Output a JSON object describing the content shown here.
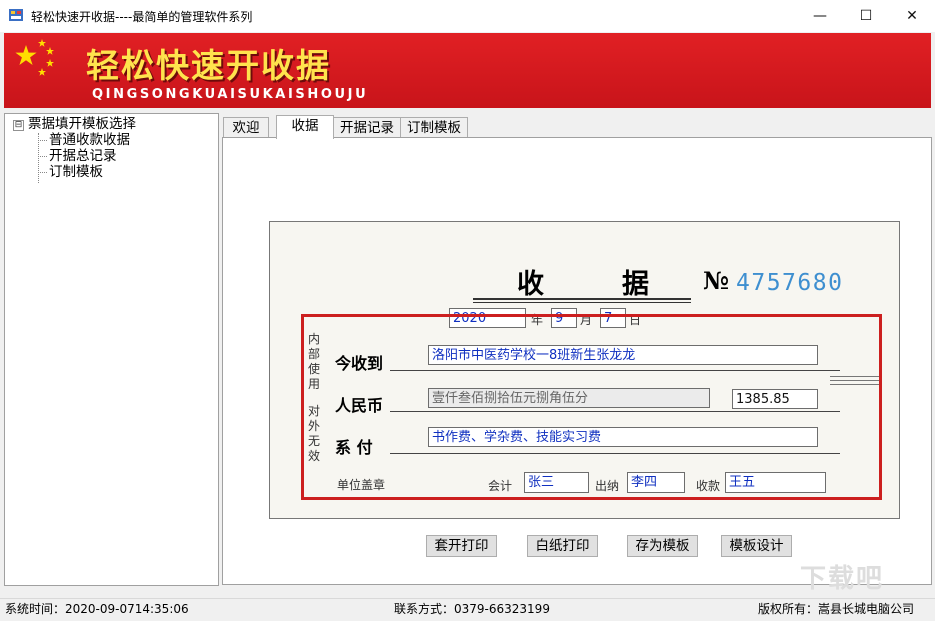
{
  "window": {
    "title": "轻松快速开收据----最简单的管理软件系列",
    "minimize_glyph": "—",
    "maximize_glyph": "☐",
    "close_glyph": "✕"
  },
  "banner": {
    "title": "轻松快速开收据",
    "subtitle": "QINGSONGKUAISUKAISHOUJU",
    "colors": {
      "background": "#d8191e",
      "title": "#ffe34d"
    }
  },
  "tree": {
    "toggle": "⊟",
    "root": "票据填开模板选择",
    "children": [
      "普通收款收据",
      "开据总记录",
      "订制模板"
    ]
  },
  "tabs": [
    "欢迎",
    "收据",
    "开据记录",
    "订制模板"
  ],
  "receipt": {
    "heading_1": "收",
    "heading_2": "据",
    "number_label": "№",
    "number": "4757680",
    "year": "2020",
    "year_label": "年",
    "month": "9",
    "month_label": "月",
    "day": "7",
    "day_label": "日",
    "side_text_1": "内部使用",
    "side_text_2": "对外无效",
    "received_from_label": "今收到",
    "received_from": "洛阳市中医药学校一8班新生张龙龙",
    "rmb_label": "人民币",
    "amount_in_words": "壹仟叁佰捌拾伍元捌角伍分",
    "amount": "1385.85",
    "purpose_label": "系  付",
    "purpose": "书作费、学杂费、技能实习费",
    "seal_label": "单位盖章",
    "accountant_label": "会计",
    "accountant": "张三",
    "cashier_label": "出纳",
    "cashier": "李四",
    "payee_label": "收款",
    "payee": "王五",
    "colors": {
      "frame": "#cc1f1f",
      "number": "#3e8fd0",
      "field_text": "#1030c0"
    }
  },
  "buttons": {
    "print_overlay": "套开打印",
    "print_blank": "白纸打印",
    "save_template": "存为模板",
    "design_template": "模板设计"
  },
  "status": {
    "time": "系统时间：2020-09-0714:35:06",
    "contact": "联系方式：0379-66323199",
    "copyright": "版权所有：嵩县长城电脑公司"
  },
  "watermark": "下载吧"
}
